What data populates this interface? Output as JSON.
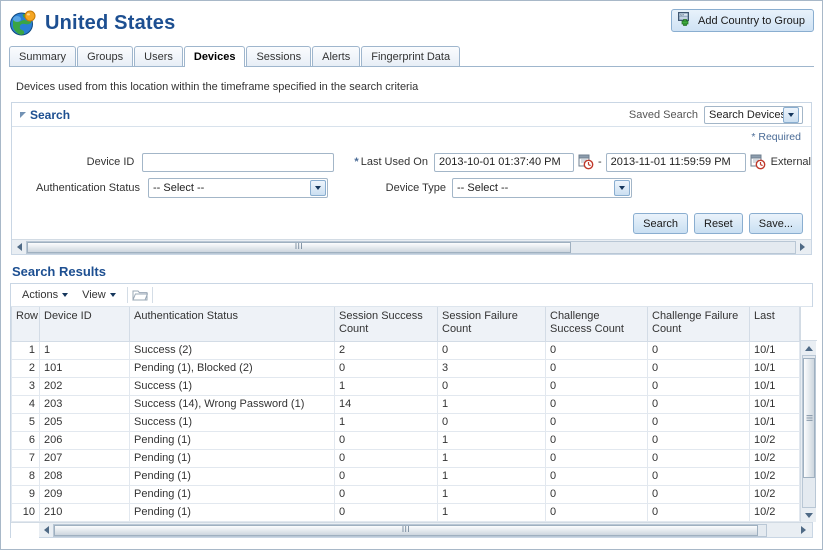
{
  "header": {
    "title": "United States",
    "globe_icon": "globe-icon",
    "add_group_button": "Add Country to Group",
    "add_group_icon": "add-group-icon"
  },
  "tabs": [
    {
      "label": "Summary",
      "active": false
    },
    {
      "label": "Groups",
      "active": false
    },
    {
      "label": "Users",
      "active": false
    },
    {
      "label": "Devices",
      "active": true
    },
    {
      "label": "Sessions",
      "active": false
    },
    {
      "label": "Alerts",
      "active": false
    },
    {
      "label": "Fingerprint Data",
      "active": false
    }
  ],
  "description": "Devices used from this location within the timeframe specified in the search criteria",
  "search": {
    "section_label": "Search",
    "disclosure_icon": "disclosure-triangle-icon",
    "saved_search_label": "Saved Search",
    "saved_search_value": "Search Devices",
    "required_note": "* Required",
    "required_star": "*",
    "fields": {
      "device_id_label": "Device ID",
      "device_id_value": "",
      "device_id_placeholder": "",
      "last_used_on_label": "Last Used On",
      "last_used_on_star": "*",
      "last_used_from": "2013-10-01 01:37:40 PM",
      "range_separator": "-",
      "last_used_to": "2013-11-01 11:59:59 PM",
      "calendar_icon": "calendar-picker-icon",
      "external_label": "External",
      "auth_status_label": "Authentication Status",
      "auth_status_value": "-- Select --",
      "device_type_label": "Device Type",
      "device_type_value": "-- Select --"
    },
    "buttons": {
      "search": "Search",
      "reset": "Reset",
      "save": "Save..."
    },
    "scroll_grip": "III"
  },
  "results": {
    "title": "Search Results",
    "toolbar": {
      "actions": "Actions",
      "view": "View",
      "detach_icon": "detach-folder-icon"
    },
    "columns": [
      "Row",
      "Device ID",
      "Authentication Status",
      "Session Success Count",
      "Session Failure Count",
      "Challenge Success Count",
      "Challenge Failure Count",
      "Last"
    ],
    "rows": [
      {
        "row": "1",
        "device_id": "1",
        "auth_status": "Success (2)",
        "session_success": "2",
        "session_failure": "0",
        "challenge_success": "0",
        "challenge_failure": "0",
        "last": "10/1"
      },
      {
        "row": "2",
        "device_id": "101",
        "auth_status": "Pending (1), Blocked (2)",
        "session_success": "0",
        "session_failure": "3",
        "challenge_success": "0",
        "challenge_failure": "0",
        "last": "10/1"
      },
      {
        "row": "3",
        "device_id": "202",
        "auth_status": "Success (1)",
        "session_success": "1",
        "session_failure": "0",
        "challenge_success": "0",
        "challenge_failure": "0",
        "last": "10/1"
      },
      {
        "row": "4",
        "device_id": "203",
        "auth_status": "Success (14), Wrong Password (1)",
        "session_success": "14",
        "session_failure": "1",
        "challenge_success": "0",
        "challenge_failure": "0",
        "last": "10/1"
      },
      {
        "row": "5",
        "device_id": "205",
        "auth_status": "Success (1)",
        "session_success": "1",
        "session_failure": "0",
        "challenge_success": "0",
        "challenge_failure": "0",
        "last": "10/1"
      },
      {
        "row": "6",
        "device_id": "206",
        "auth_status": "Pending (1)",
        "session_success": "0",
        "session_failure": "1",
        "challenge_success": "0",
        "challenge_failure": "0",
        "last": "10/2"
      },
      {
        "row": "7",
        "device_id": "207",
        "auth_status": "Pending (1)",
        "session_success": "0",
        "session_failure": "1",
        "challenge_success": "0",
        "challenge_failure": "0",
        "last": "10/2"
      },
      {
        "row": "8",
        "device_id": "208",
        "auth_status": "Pending (1)",
        "session_success": "0",
        "session_failure": "1",
        "challenge_success": "0",
        "challenge_failure": "0",
        "last": "10/2"
      },
      {
        "row": "9",
        "device_id": "209",
        "auth_status": "Pending (1)",
        "session_success": "0",
        "session_failure": "1",
        "challenge_success": "0",
        "challenge_failure": "0",
        "last": "10/2"
      },
      {
        "row": "10",
        "device_id": "210",
        "auth_status": "Pending (1)",
        "session_success": "0",
        "session_failure": "1",
        "challenge_success": "0",
        "challenge_failure": "0",
        "last": "10/2"
      }
    ],
    "scroll_grip": "III",
    "vscroll_grip": "III"
  },
  "colors": {
    "title_blue": "#1d4f91",
    "link_blue": "#2b4f8c",
    "button_blue": "#c9dff2",
    "border": "#9fb6cd",
    "header_bg": "#eef2f7"
  }
}
